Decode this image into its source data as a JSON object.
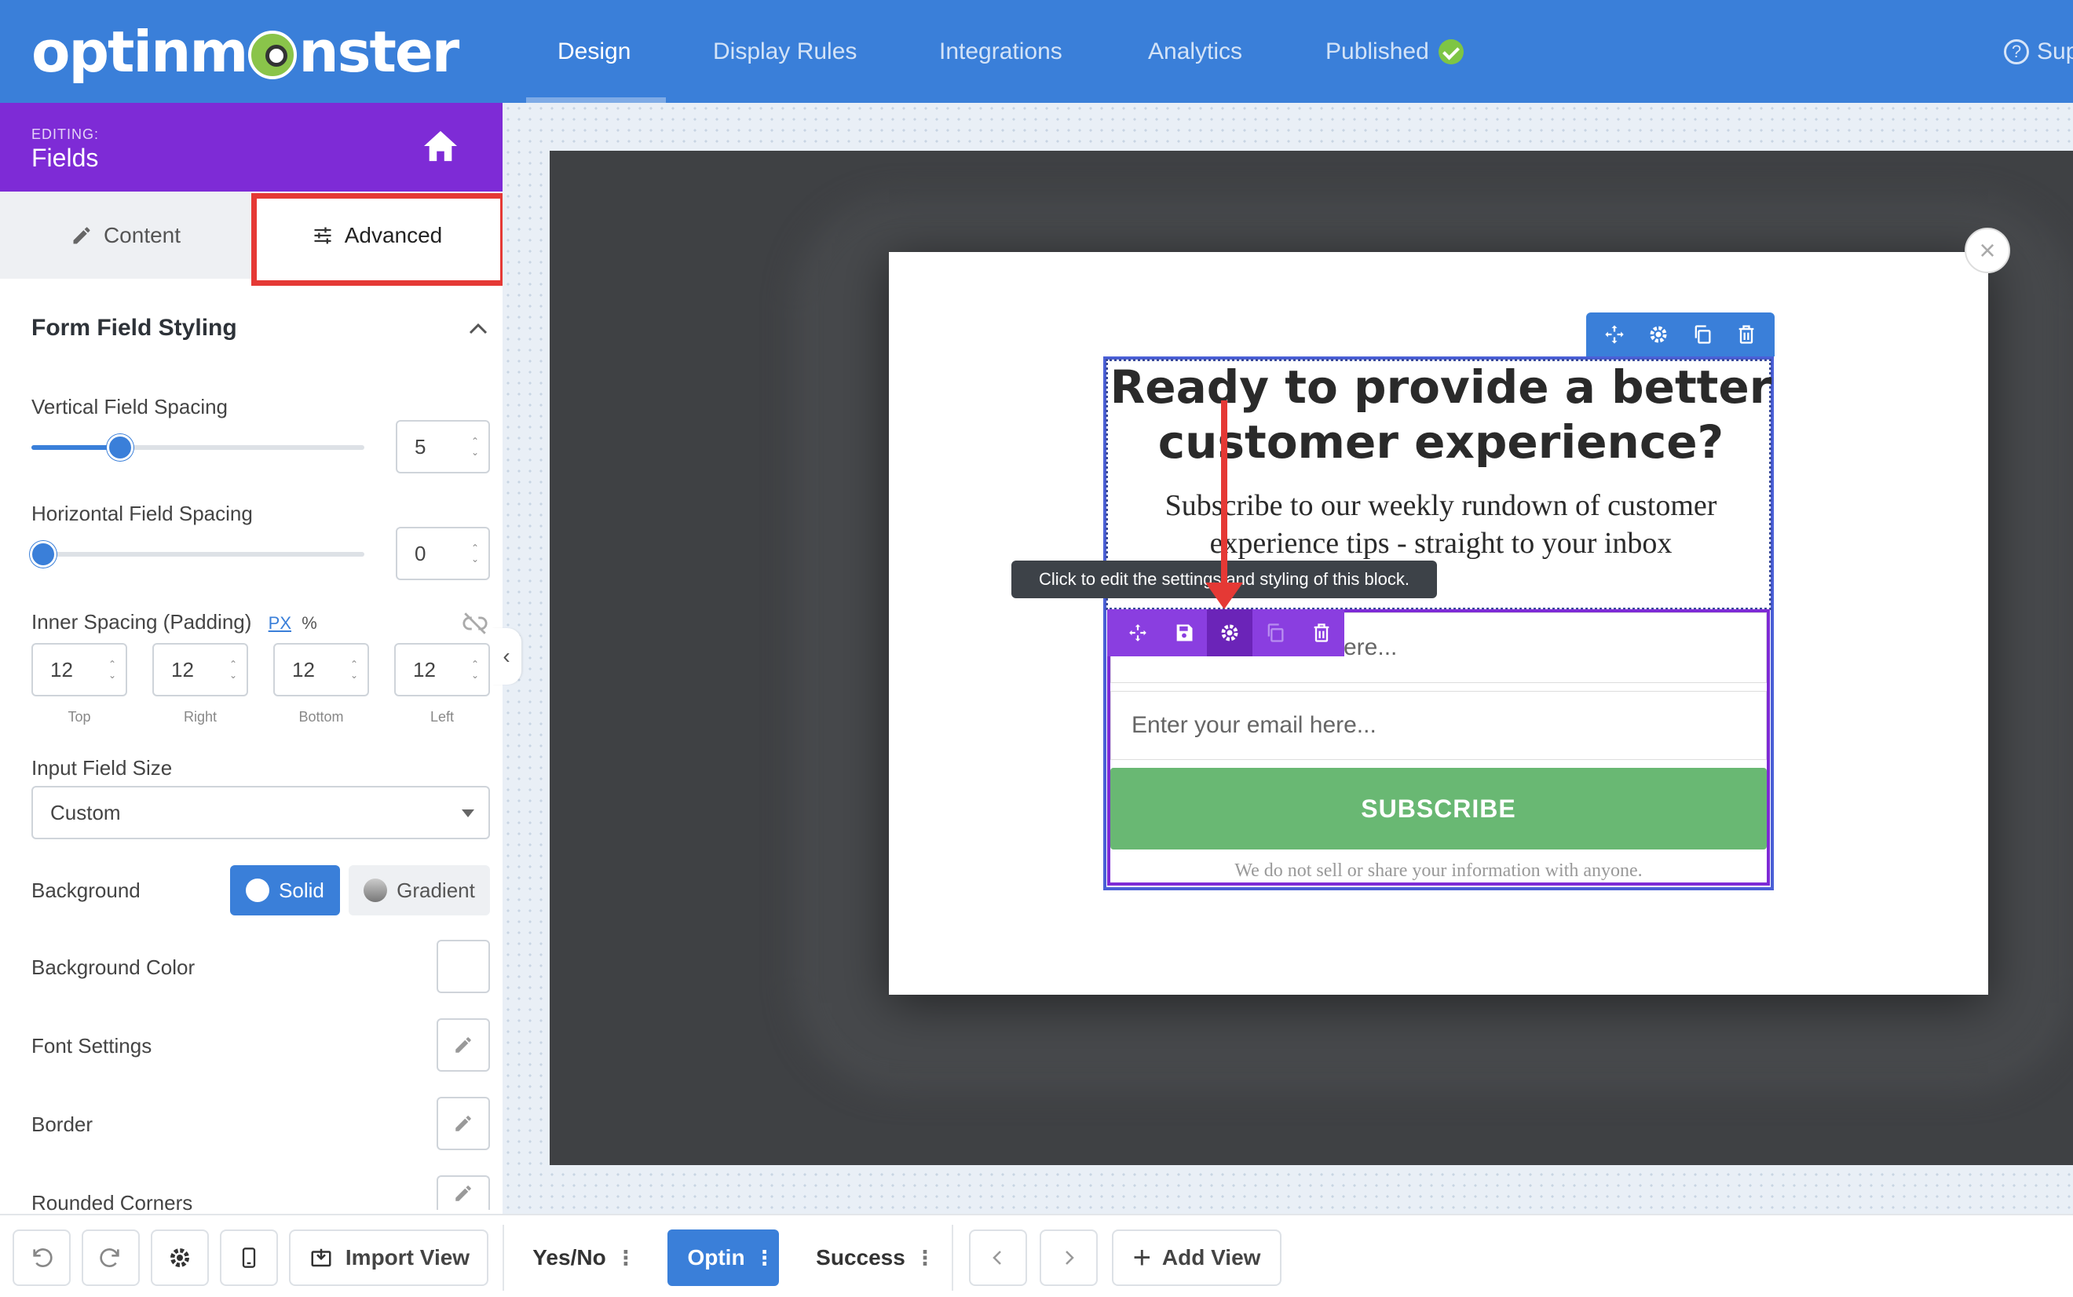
{
  "brand": {
    "logo_text_left": "optinm",
    "logo_text_right": "nster"
  },
  "nav": {
    "tabs": [
      {
        "label": "Design"
      },
      {
        "label": "Display Rules"
      },
      {
        "label": "Integrations"
      },
      {
        "label": "Analytics"
      },
      {
        "label": "Published"
      }
    ],
    "support_label": "Sup"
  },
  "sidebar": {
    "editing_label": "EDITING:",
    "editing_title": "Fields",
    "tab_content": "Content",
    "tab_advanced": "Advanced",
    "section_title": "Form Field Styling",
    "vertical_spacing": {
      "label": "Vertical Field Spacing",
      "value": "5"
    },
    "horizontal_spacing": {
      "label": "Horizontal Field Spacing",
      "value": "0"
    },
    "padding": {
      "label": "Inner Spacing (Padding)",
      "unit_px": "PX",
      "unit_pct": "%",
      "values": [
        "12",
        "12",
        "12",
        "12"
      ],
      "sides": [
        "Top",
        "Right",
        "Bottom",
        "Left"
      ]
    },
    "input_size": {
      "label": "Input Field Size",
      "value": "Custom"
    },
    "background": {
      "label": "Background",
      "solid": "Solid",
      "gradient": "Gradient"
    },
    "background_color_label": "Background Color",
    "font_settings_label": "Font Settings",
    "border_label": "Border",
    "rounded_corners_label": "Rounded Corners"
  },
  "popup": {
    "headline": "Ready to provide a better customer experience?",
    "subheadline": "Subscribe to our weekly rundown of customer experience tips - straight to your inbox",
    "name_placeholder_tail": "ere...",
    "email_placeholder": "Enter your email here...",
    "subscribe_label": "SUBSCRIBE",
    "disclaimer": "We do not sell or share your information with anyone.",
    "tooltip": "Click to edit the settings and styling of this block."
  },
  "bottombar": {
    "import_view": "Import View",
    "views": [
      "Yes/No",
      "Optin",
      "Success"
    ],
    "add_view": "Add View"
  },
  "colors": {
    "nav_blue": "#3a7fd9",
    "purple": "#7e2bd6",
    "green": "#69b873",
    "highlight_red": "#e53935"
  }
}
